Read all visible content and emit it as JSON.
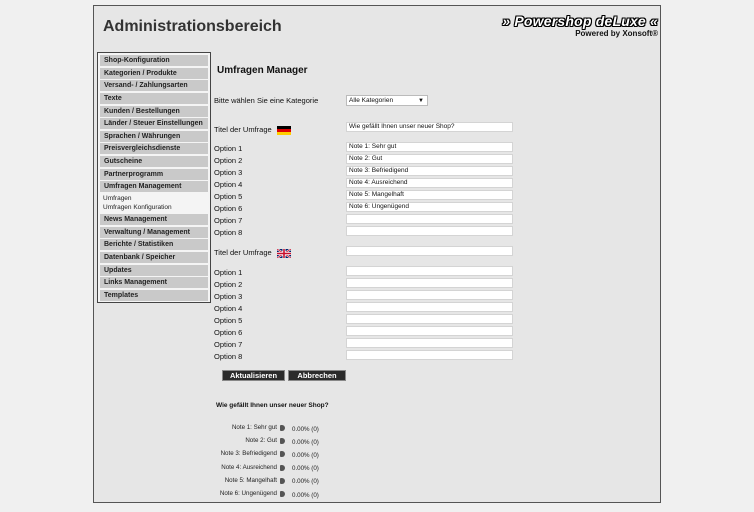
{
  "header": {
    "title": "Administrationsbereich",
    "brand": "» Powershop deLuxe «",
    "brand_sub": "Powered by Xonsoft®"
  },
  "sidebar": {
    "items": [
      {
        "label": "Shop-Konfiguration"
      },
      {
        "label": "Kategorien / Produkte"
      },
      {
        "label": "Versand- / Zahlungsarten"
      },
      {
        "label": "Texte"
      },
      {
        "label": "Kunden / Bestellungen"
      },
      {
        "label": "Länder / Steuer Einstellungen"
      },
      {
        "label": "Sprachen / Währungen"
      },
      {
        "label": "Preisvergleichsdienste"
      },
      {
        "label": "Gutscheine"
      },
      {
        "label": "Partnerprogramm"
      },
      {
        "label": "Umfragen Management"
      }
    ],
    "subitems": [
      "Umfragen",
      "Umfragen Konfiguration"
    ],
    "items_after": [
      {
        "label": "News Management"
      },
      {
        "label": "Verwaltung / Management"
      },
      {
        "label": "Berichte / Statistiken"
      },
      {
        "label": "Datenbank / Speicher"
      },
      {
        "label": "Updates"
      },
      {
        "label": "Links Management"
      },
      {
        "label": "Templates"
      }
    ]
  },
  "main": {
    "section_title": "Umfragen Manager",
    "category_label": "Bitte wählen Sie eine Kategorie",
    "category_value": "Alle Kategorien",
    "de": {
      "title_label": "Titel der Umfrage",
      "title_value": "Wie gefällt Ihnen unser neuer Shop?",
      "options": [
        {
          "label": "Option 1",
          "value": "Note 1: Sehr gut"
        },
        {
          "label": "Option 2",
          "value": "Note 2: Gut"
        },
        {
          "label": "Option 3",
          "value": "Note 3: Befriedigend"
        },
        {
          "label": "Option 4",
          "value": "Note 4: Ausreichend"
        },
        {
          "label": "Option 5",
          "value": "Note 5: Mangelhaft"
        },
        {
          "label": "Option 6",
          "value": "Note 6: Ungenügend"
        },
        {
          "label": "Option 7",
          "value": ""
        },
        {
          "label": "Option 8",
          "value": ""
        }
      ]
    },
    "en": {
      "title_label": "Titel der Umfrage",
      "title_value": "",
      "options": [
        {
          "label": "Option 1",
          "value": ""
        },
        {
          "label": "Option 2",
          "value": ""
        },
        {
          "label": "Option 3",
          "value": ""
        },
        {
          "label": "Option 4",
          "value": ""
        },
        {
          "label": "Option 5",
          "value": ""
        },
        {
          "label": "Option 6",
          "value": ""
        },
        {
          "label": "Option 7",
          "value": ""
        },
        {
          "label": "Option 8",
          "value": ""
        }
      ]
    },
    "buttons": {
      "update": "Aktualisieren",
      "cancel": "Abbrechen"
    }
  },
  "results": {
    "question": "Wie gefällt Ihnen unser neuer Shop?",
    "rows": [
      {
        "label": "Note 1: Sehr gut",
        "value": "0.00% (0)"
      },
      {
        "label": "Note 2: Gut",
        "value": "0.00% (0)"
      },
      {
        "label": "Note 3: Befriedigend",
        "value": "0.00% (0)"
      },
      {
        "label": "Note 4: Ausreichend",
        "value": "0.00% (0)"
      },
      {
        "label": "Note 5: Mangelhaft",
        "value": "0.00% (0)"
      },
      {
        "label": "Note 6: Ungenügend",
        "value": "0.00% (0)"
      }
    ]
  },
  "colors": {
    "nav_bg": "#c9c9c9",
    "button_bg": "#2b2b2b",
    "frame_bg": "#e6e6e6"
  },
  "icons": {
    "de_flag": "german-flag-icon",
    "en_flag": "uk-flag-icon",
    "result_bar": "result-bar-icon"
  }
}
